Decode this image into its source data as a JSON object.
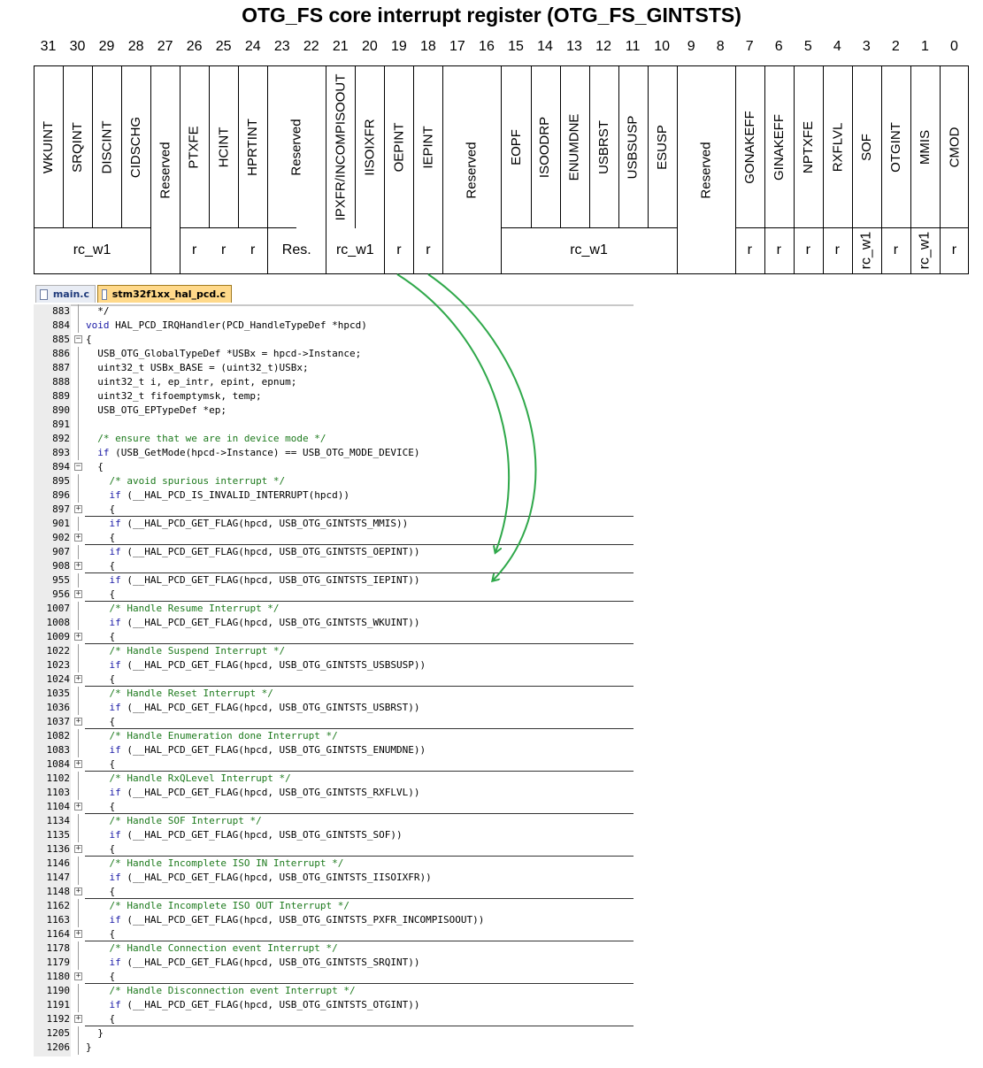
{
  "title": "OTG_FS core interrupt register (OTG_FS_GINTSTS)",
  "bit_numbers": [
    "31",
    "30",
    "29",
    "28",
    "27",
    "26",
    "25",
    "24",
    "23",
    "22",
    "21",
    "20",
    "19",
    "18",
    "17",
    "16",
    "15",
    "14",
    "13",
    "12",
    "11",
    "10",
    "9",
    "8",
    "7",
    "6",
    "5",
    "4",
    "3",
    "2",
    "1",
    "0"
  ],
  "fields": [
    "WKUINT",
    "SRQINT",
    "DISCINT",
    "CIDSCHG",
    "Reserved",
    "PTXFE",
    "HCINT",
    "HPRTINT",
    "Reserved",
    "IPXFR/INCOMPISOOUT",
    "IISOIXFR",
    "OEPINT",
    "IEPINT",
    "Reserved",
    "EOPF",
    "ISOODRP",
    "ENUMDNE",
    "USBRST",
    "USBSUSP",
    "ESUSP",
    "Reserved",
    "GONAKEFF",
    "GINAKEFF",
    "NPTXFE",
    "RXFLVL",
    "SOF",
    "OTGINT",
    "MMIS",
    "CMOD"
  ],
  "access": [
    "rc_w1",
    "r",
    "r",
    "r",
    "Res.",
    "rc_w1",
    "r",
    "r",
    "rc_w1",
    "r",
    "r",
    "r",
    "r",
    "rc_w1",
    "r",
    "rc_w1",
    "r"
  ],
  "editor": {
    "tabs": [
      "main.c",
      "stm32f1xx_hal_pcd.c"
    ],
    "lines": [
      {
        "num": "883",
        "code": "  */"
      },
      {
        "num": "884",
        "code": "void HAL_PCD_IRQHandler(PCD_HandleTypeDef *hpcd)"
      },
      {
        "num": "885",
        "code": "{"
      },
      {
        "num": "886",
        "code": "  USB_OTG_GlobalTypeDef *USBx = hpcd->Instance;"
      },
      {
        "num": "887",
        "code": "  uint32_t USBx_BASE = (uint32_t)USBx;"
      },
      {
        "num": "888",
        "code": "  uint32_t i, ep_intr, epint, epnum;"
      },
      {
        "num": "889",
        "code": "  uint32_t fifoemptymsk, temp;"
      },
      {
        "num": "890",
        "code": "  USB_OTG_EPTypeDef *ep;"
      },
      {
        "num": "891",
        "code": ""
      },
      {
        "num": "892",
        "code": "  /* ensure that we are in device mode */"
      },
      {
        "num": "893",
        "code": "  if (USB_GetMode(hpcd->Instance) == USB_OTG_MODE_DEVICE)"
      },
      {
        "num": "894",
        "code": "  {"
      },
      {
        "num": "895",
        "code": "    /* avoid spurious interrupt */"
      },
      {
        "num": "896",
        "code": "    if (__HAL_PCD_IS_INVALID_INTERRUPT(hpcd))"
      },
      {
        "num": "897",
        "code": "    {"
      },
      {
        "num": "901",
        "code": "    if (__HAL_PCD_GET_FLAG(hpcd, USB_OTG_GINTSTS_MMIS))"
      },
      {
        "num": "902",
        "code": "    {"
      },
      {
        "num": "907",
        "code": "    if (__HAL_PCD_GET_FLAG(hpcd, USB_OTG_GINTSTS_OEPINT))"
      },
      {
        "num": "908",
        "code": "    {"
      },
      {
        "num": "955",
        "code": "    if (__HAL_PCD_GET_FLAG(hpcd, USB_OTG_GINTSTS_IEPINT))"
      },
      {
        "num": "956",
        "code": "    {"
      },
      {
        "num": "1007",
        "code": "    /* Handle Resume Interrupt */"
      },
      {
        "num": "1008",
        "code": "    if (__HAL_PCD_GET_FLAG(hpcd, USB_OTG_GINTSTS_WKUINT))"
      },
      {
        "num": "1009",
        "code": "    {"
      },
      {
        "num": "1022",
        "code": "    /* Handle Suspend Interrupt */"
      },
      {
        "num": "1023",
        "code": "    if (__HAL_PCD_GET_FLAG(hpcd, USB_OTG_GINTSTS_USBSUSP))"
      },
      {
        "num": "1024",
        "code": "    {"
      },
      {
        "num": "1035",
        "code": "    /* Handle Reset Interrupt */"
      },
      {
        "num": "1036",
        "code": "    if (__HAL_PCD_GET_FLAG(hpcd, USB_OTG_GINTSTS_USBRST))"
      },
      {
        "num": "1037",
        "code": "    {"
      },
      {
        "num": "1082",
        "code": "    /* Handle Enumeration done Interrupt */"
      },
      {
        "num": "1083",
        "code": "    if (__HAL_PCD_GET_FLAG(hpcd, USB_OTG_GINTSTS_ENUMDNE))"
      },
      {
        "num": "1084",
        "code": "    {"
      },
      {
        "num": "1102",
        "code": "    /* Handle RxQLevel Interrupt */"
      },
      {
        "num": "1103",
        "code": "    if (__HAL_PCD_GET_FLAG(hpcd, USB_OTG_GINTSTS_RXFLVL))"
      },
      {
        "num": "1104",
        "code": "    {"
      },
      {
        "num": "1134",
        "code": "    /* Handle SOF Interrupt */"
      },
      {
        "num": "1135",
        "code": "    if (__HAL_PCD_GET_FLAG(hpcd, USB_OTG_GINTSTS_SOF))"
      },
      {
        "num": "1136",
        "code": "    {"
      },
      {
        "num": "1146",
        "code": "    /* Handle Incomplete ISO IN Interrupt */"
      },
      {
        "num": "1147",
        "code": "    if (__HAL_PCD_GET_FLAG(hpcd, USB_OTG_GINTSTS_IISOIXFR))"
      },
      {
        "num": "1148",
        "code": "    {"
      },
      {
        "num": "1162",
        "code": "    /* Handle Incomplete ISO OUT Interrupt */"
      },
      {
        "num": "1163",
        "code": "    if (__HAL_PCD_GET_FLAG(hpcd, USB_OTG_GINTSTS_PXFR_INCOMPISOOUT))"
      },
      {
        "num": "1164",
        "code": "    {"
      },
      {
        "num": "1178",
        "code": "    /* Handle Connection event Interrupt */"
      },
      {
        "num": "1179",
        "code": "    if (__HAL_PCD_GET_FLAG(hpcd, USB_OTG_GINTSTS_SRQINT))"
      },
      {
        "num": "1180",
        "code": "    {"
      },
      {
        "num": "1190",
        "code": "    /* Handle Disconnection event Interrupt */"
      },
      {
        "num": "1191",
        "code": "    if (__HAL_PCD_GET_FLAG(hpcd, USB_OTG_GINTSTS_OTGINT))"
      },
      {
        "num": "1192",
        "code": "    {"
      },
      {
        "num": "1205",
        "code": "  }"
      },
      {
        "num": "1206",
        "code": "}"
      }
    ]
  },
  "colors": {
    "arrow": "#2fa84a",
    "keyword": "#1a1aa6",
    "comment": "#1d7a1d",
    "active_tab": "#ffd98a",
    "gutter": "#ececec"
  }
}
